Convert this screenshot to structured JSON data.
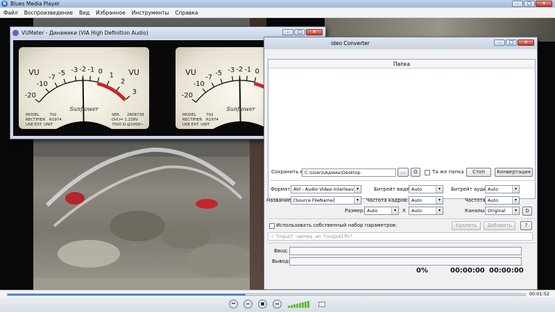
{
  "player": {
    "title": "Blues Media Player",
    "menu": [
      "Файл",
      "Воспроизведение",
      "Вид",
      "Избранное",
      "Инструменты",
      "Справка"
    ],
    "time": "00:01:52",
    "progress": 0.46,
    "volume_bars": 8
  },
  "vumeter": {
    "title": "VUMeter - Динамики (VIA High Definition Audio)",
    "scale_labels": [
      "-20",
      "-10",
      "-7",
      "-5",
      "-3",
      "-2",
      "-1",
      "0",
      "1",
      "2",
      "3"
    ],
    "vu_label": "VU",
    "brand": "Sunflower",
    "model_text": [
      "MODEL",
      "702",
      "RECTIFIER",
      "R1974",
      "USE EXT. UNIT"
    ],
    "ser_text": [
      "SER.",
      "2808739",
      "OVU",
      "= 1.228V",
      "7500 Ω @1000~"
    ],
    "needle_db": [
      -2.0,
      -2.0
    ]
  },
  "converter": {
    "title": "ideo Converter",
    "list_header": "Папка",
    "save_label": "Сохранить в:",
    "save_path": "C:\\Users\\Админ\\Desktop",
    "browse_btn": "...",
    "open_btn": "O",
    "same_folder": "Та же папка",
    "stop_btn": "Стоп",
    "convert_btn": "Конвертация",
    "format_label": "Формат:",
    "format_value": "AVI - Audio Video Interleave",
    "name_label": "Название:",
    "name_value": "[Source FileName]",
    "vbitrate_label": "Битрейт видео:",
    "vbitrate_value": "Auto",
    "abitrate_label": "Битрейт аудио:",
    "abitrate_value": "Auto",
    "framerate_label": "Частота кадров:",
    "framerate_value": "Auto",
    "freq_label": "Частота:",
    "freq_value": "Auto",
    "size_label": "Размер:",
    "size_w": "Auto",
    "size_x": "X",
    "size_h": "Auto",
    "channels_label": "Каналы:",
    "channels_value": "Original",
    "d_btn": "D",
    "custom_label": "Использовать собственный набор параметров:",
    "delete_btn": "Удалить",
    "add_btn": "Добавить",
    "help_btn": "?",
    "command": "-i \"[input]\" -sameq -an \"[output].flv\"",
    "input_label": "Ввод:",
    "output_label": "Вывод:",
    "percent": "0%",
    "elapsed": "00:00:00",
    "remaining": "00:00:00"
  },
  "window_buttons": {
    "min": "–",
    "max": "□",
    "close": "✕"
  }
}
